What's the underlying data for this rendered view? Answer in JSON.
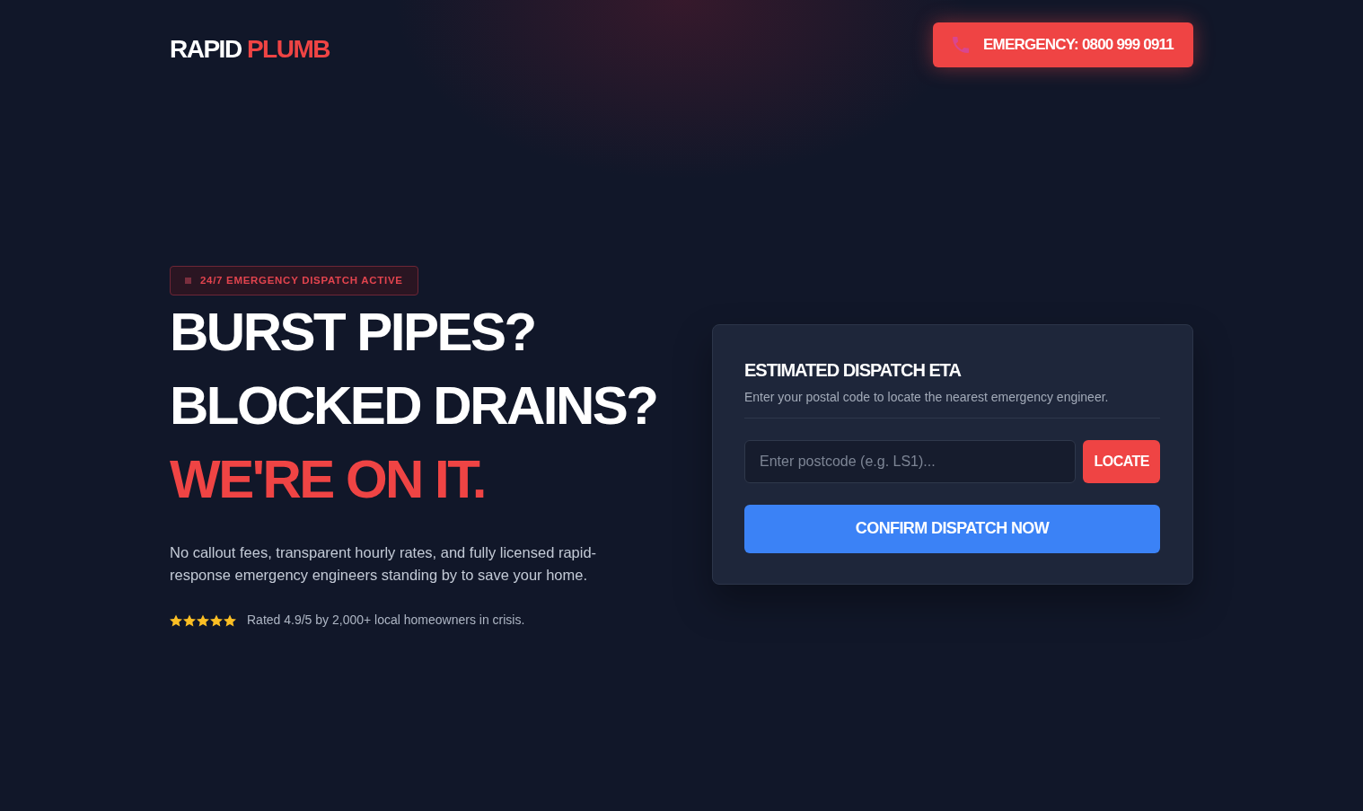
{
  "brand": {
    "parts": [
      {
        "text": "RAPID",
        "highlighted": false
      },
      {
        "text": "PLUMB",
        "highlighted": true
      }
    ]
  },
  "emergency_button": {
    "label": "EMERGENCY: 0800 999 0911"
  },
  "hero": {
    "badge": "24/7 EMERGENCY DISPATCH ACTIVE",
    "headline": [
      {
        "text": "BURST PIPES?",
        "highlighted": false
      },
      {
        "text": "BLOCKED DRAINS?",
        "highlighted": false
      },
      {
        "text": "WE'RE ON IT.",
        "highlighted": true
      }
    ],
    "description": "No callout fees, transparent hourly rates, and fully licensed rapid-response emergency engineers standing by to save your home.",
    "rating": {
      "stars": 5,
      "text": "Rated 4.9/5 by 2,000+ local homeowners in crisis."
    }
  },
  "dispatch_card": {
    "title": "ESTIMATED DISPATCH ETA",
    "subtitle": "Enter your postal code to locate the nearest emergency engineer.",
    "postcode_field": {
      "placeholder": "Enter postcode (e.g. LS1)..."
    },
    "locate_button": "LOCATE",
    "confirm_button": "CONFIRM DISPATCH NOW"
  }
}
